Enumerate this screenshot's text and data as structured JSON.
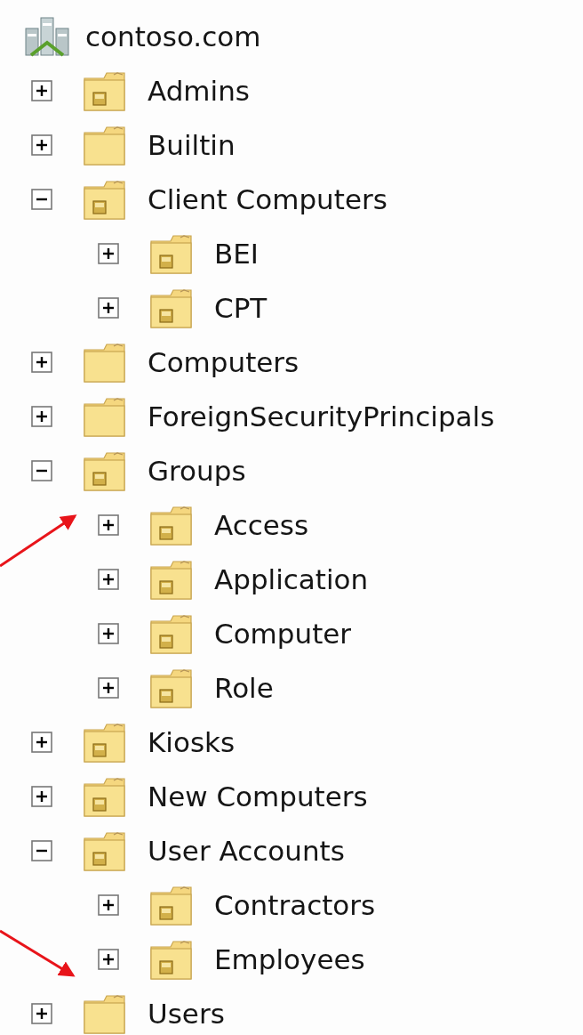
{
  "tree": {
    "label": "contoso.com",
    "children": [
      {
        "label": "Admins",
        "kind": "ou",
        "expanded": false
      },
      {
        "label": "Builtin",
        "kind": "container",
        "expanded": false
      },
      {
        "label": "Client Computers",
        "kind": "ou",
        "expanded": true,
        "children": [
          {
            "label": "BEI",
            "kind": "ou",
            "expanded": false
          },
          {
            "label": "CPT",
            "kind": "ou",
            "expanded": false
          }
        ]
      },
      {
        "label": "Computers",
        "kind": "container",
        "expanded": false
      },
      {
        "label": "ForeignSecurityPrincipals",
        "kind": "container",
        "expanded": false
      },
      {
        "label": "Groups",
        "kind": "ou",
        "expanded": true,
        "children": [
          {
            "label": "Access",
            "kind": "ou",
            "expanded": false
          },
          {
            "label": "Application",
            "kind": "ou",
            "expanded": false
          },
          {
            "label": "Computer",
            "kind": "ou",
            "expanded": false
          },
          {
            "label": "Role",
            "kind": "ou",
            "expanded": false
          }
        ]
      },
      {
        "label": "Kiosks",
        "kind": "ou",
        "expanded": false
      },
      {
        "label": "New Computers",
        "kind": "ou",
        "expanded": false
      },
      {
        "label": "User Accounts",
        "kind": "ou",
        "expanded": true,
        "children": [
          {
            "label": "Contractors",
            "kind": "ou",
            "expanded": false
          },
          {
            "label": "Employees",
            "kind": "ou",
            "expanded": false
          }
        ]
      },
      {
        "label": "Users",
        "kind": "container",
        "expanded": false
      }
    ]
  }
}
